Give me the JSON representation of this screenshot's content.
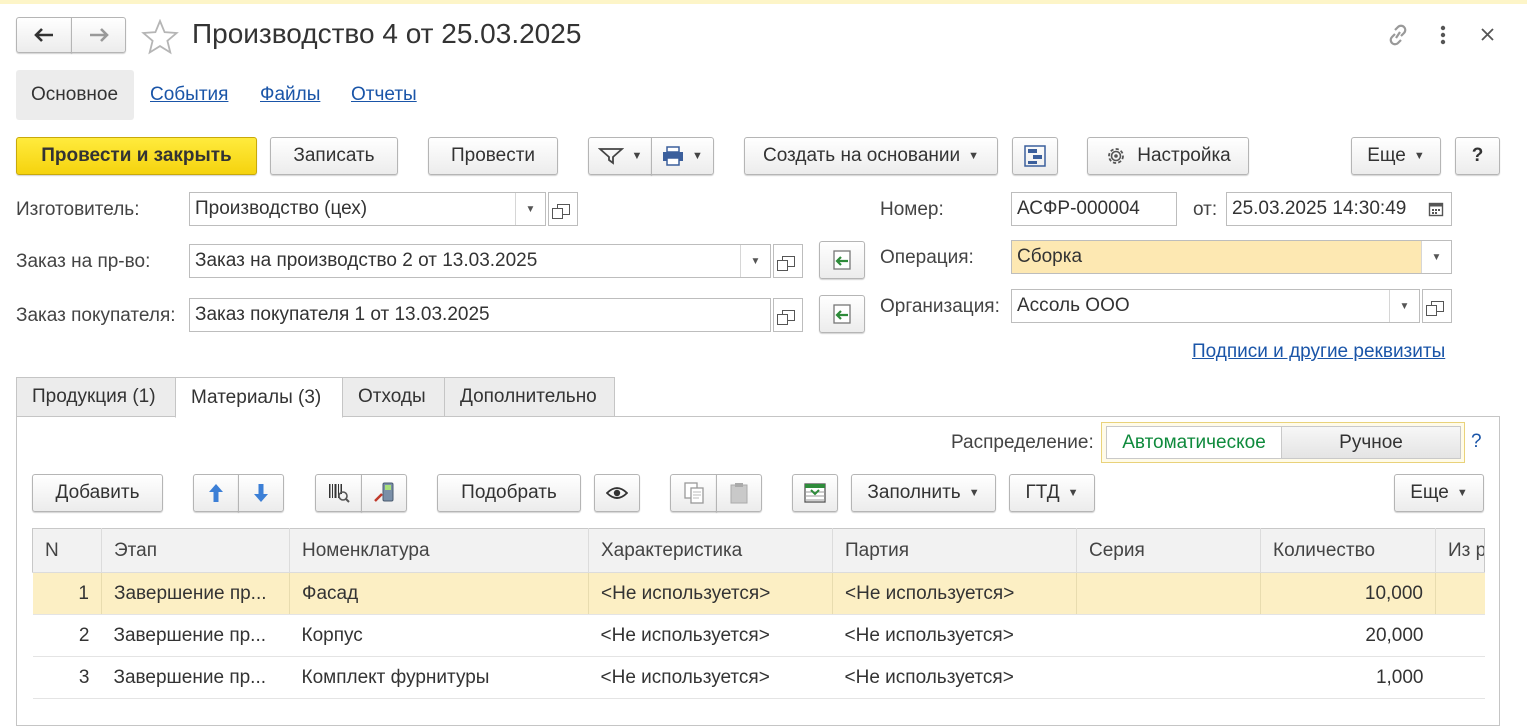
{
  "window": {
    "title": "Производство 4 от 25.03.2025"
  },
  "nav": {
    "tabs": [
      "Основное",
      "События",
      "Файлы",
      "Отчеты"
    ]
  },
  "toolbar": {
    "post_close": "Провести и закрыть",
    "write": "Записать",
    "post": "Провести",
    "create_based": "Создать на основании",
    "settings": "Настройка",
    "more": "Еще",
    "help": "?"
  },
  "fields": {
    "maker_label": "Изготовитель:",
    "maker_value": "Производство (цех)",
    "order_label": "Заказ на пр-во:",
    "order_value": "Заказ на производство 2 от 13.03.2025",
    "customer_label": "Заказ покупателя:",
    "customer_value": "Заказ покупателя 1 от 13.03.2025",
    "number_label": "Номер:",
    "number_value": "АСФР-000004",
    "date_label": "от:",
    "date_value": "25.03.2025 14:30:49",
    "operation_label": "Операция:",
    "operation_value": "Сборка",
    "org_label": "Организация:",
    "org_value": "Ассоль ООО",
    "signatures_link": "Подписи и другие реквизиты"
  },
  "page_tabs": [
    "Продукция (1)",
    "Материалы (3)",
    "Отходы",
    "Дополнительно"
  ],
  "distribution": {
    "label": "Распределение:",
    "auto": "Автоматическое",
    "manual": "Ручное",
    "help": "?"
  },
  "table_toolbar": {
    "add": "Добавить",
    "pick": "Подобрать",
    "fill": "Заполнить",
    "gtd": "ГТД",
    "more": "Еще"
  },
  "table": {
    "columns": [
      "N",
      "Этап",
      "Номенклатура",
      "Характеристика",
      "Партия",
      "Серия",
      "Количество",
      "Из р"
    ],
    "rows": [
      {
        "n": "1",
        "stage": "Завершение пр...",
        "item": "Фасад",
        "char": "<Не используется>",
        "batch": "<Не используется>",
        "series": "",
        "qty": "10,000"
      },
      {
        "n": "2",
        "stage": "Завершение пр...",
        "item": "Корпус",
        "char": "<Не используется>",
        "batch": "<Не используется>",
        "series": "",
        "qty": "20,000"
      },
      {
        "n": "3",
        "stage": "Завершение пр...",
        "item": "Комплект фурнитуры",
        "char": "<Не используется>",
        "batch": "<Не используется>",
        "series": "",
        "qty": "1,000"
      }
    ]
  },
  "colors": {
    "primary_button": "#f5d30e",
    "link": "#1a55a8",
    "selected_row": "#fcefc4",
    "highlight_field": "#fde8b2",
    "auto_option": "#0f8a3c"
  },
  "icons": [
    "back-arrow-icon",
    "forward-arrow-icon",
    "star-icon",
    "link-icon",
    "kebab-menu-icon",
    "close-icon",
    "filter-icon",
    "print-icon",
    "structure-icon",
    "gear-icon",
    "calendar-icon",
    "fill-from-order-icon",
    "arrow-up-icon",
    "arrow-down-icon",
    "barcode-icon",
    "scanner-icon",
    "eye-icon",
    "copy-icon",
    "paste-icon",
    "fill-table-icon"
  ]
}
